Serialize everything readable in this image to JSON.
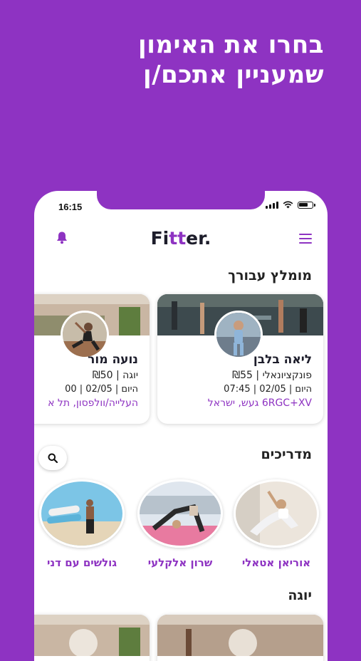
{
  "promo": {
    "headline_line1": "בחרו את האימון",
    "headline_line2": "שמעניין אתכם/ן"
  },
  "status_bar": {
    "time": "16:15"
  },
  "header": {
    "logo_prefix": "Fi",
    "logo_accent": "tt",
    "logo_suffix": "er."
  },
  "recommended": {
    "title": "מומלץ עבורך",
    "cards": [
      {
        "name": "ליאה בלבן",
        "category": "פונקציונאלי",
        "price": "₪55",
        "day": "היום",
        "date": "02/05",
        "time": "07:45",
        "location": "6RGC+XV געש, ישראל"
      },
      {
        "name": "נועה מור",
        "category": "יוגה",
        "price": "₪50",
        "day": "היום",
        "date": "02/05",
        "time": "00",
        "location": "העלייה/וולפסון, תל א"
      }
    ]
  },
  "trainers": {
    "title": "מדריכים",
    "items": [
      {
        "name": "אוריאן אטאלי"
      },
      {
        "name": "שרון אלקלעי"
      },
      {
        "name": "גולשים עם דני"
      }
    ]
  },
  "yoga": {
    "title": "יוגה"
  },
  "icons": {
    "bell": "bell-icon",
    "menu": "hamburger-menu-icon",
    "search": "search-icon"
  },
  "colors": {
    "brand": "#8e33c2",
    "text": "#1d1d2b"
  }
}
